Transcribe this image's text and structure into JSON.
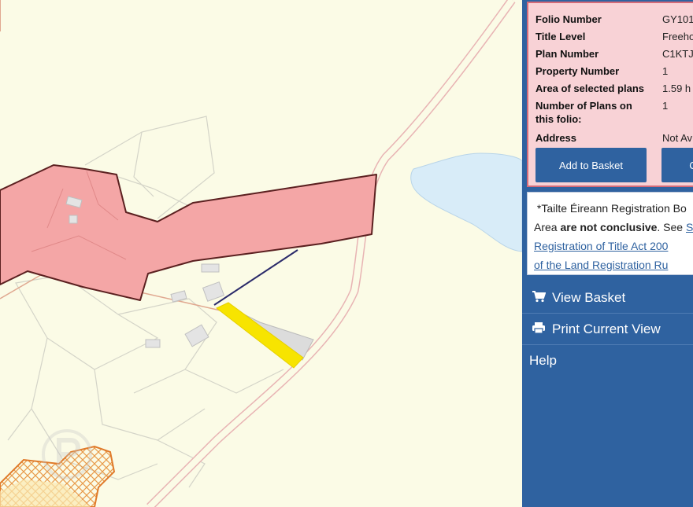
{
  "folio": {
    "rows": [
      {
        "label": "Folio Number",
        "value": "GY101"
      },
      {
        "label": "Title Level",
        "value": "Freeho"
      },
      {
        "label": "Plan Number",
        "value": "C1KTJ"
      },
      {
        "label": "Property Number",
        "value": "1"
      },
      {
        "label": "Area of selected plans",
        "value": "1.59 h"
      },
      {
        "label": "Number of Plans on this folio:",
        "value": "1"
      },
      {
        "label": "Address",
        "value": "Not Av"
      }
    ],
    "add_to_basket": "Add to Basket",
    "second_button": "C"
  },
  "notice": {
    "line1": "*Tailte Éireann Registration Bo",
    "line2_pre": "Area ",
    "line2_bold": "are not conclusive",
    "line2_post": ". See ",
    "line2_link": "S",
    "link_line1": "Registration of Title Act 200",
    "link_line2": "of the Land Registration Ru"
  },
  "menu": {
    "view_basket": "View Basket",
    "print_view": "Print Current View",
    "help": "Help"
  },
  "icons": {
    "basket": "cart-icon",
    "print": "printer-icon"
  },
  "colors": {
    "panel": "#2f62a0",
    "folio_bg": "#f8d2d6",
    "selected_parcel": "#f4a6a6",
    "highlight_parcel": "#f7e400",
    "lake": "#d8ecf8",
    "map_bg": "#fbfbe6"
  }
}
